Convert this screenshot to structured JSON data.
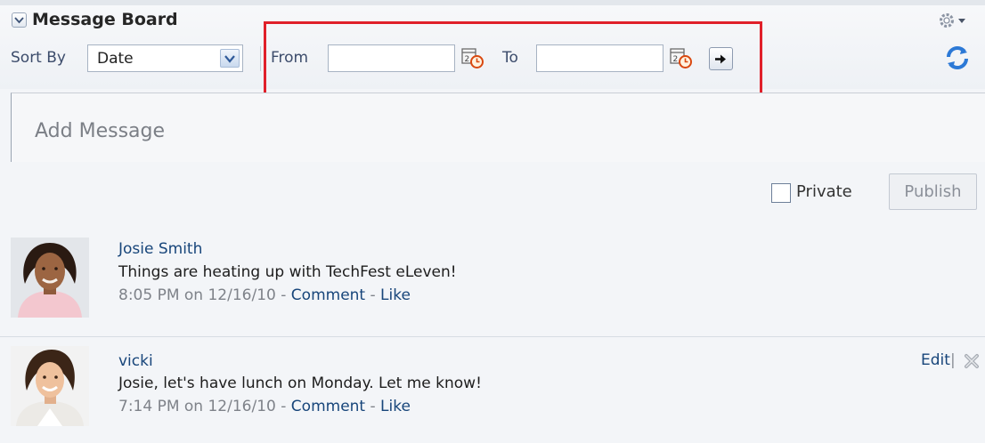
{
  "header": {
    "title": "Message Board",
    "collapse_icon": "chevron-down-icon",
    "settings_icon": "gear-icon"
  },
  "filter": {
    "sort_label": "Sort By",
    "sort_value": "Date",
    "from_label": "From",
    "from_value": "",
    "to_label": "To",
    "to_value": "",
    "go_icon": "arrow-right-icon",
    "refresh_icon": "refresh-icon"
  },
  "composer": {
    "placeholder": "Add Message",
    "private_label": "Private",
    "private_checked": false,
    "publish_label": "Publish"
  },
  "messages": [
    {
      "author": "Josie Smith",
      "text": "Things are heating up with TechFest eLeven!",
      "time": "8:05 PM on 12/16/10",
      "sep1": " - ",
      "comment": "Comment",
      "sep2": " - ",
      "like": "Like"
    },
    {
      "author": "vicki",
      "text": "Josie, let's have lunch on Monday. Let me know!",
      "time": "7:14 PM on 12/16/10",
      "sep1": " - ",
      "comment": "Comment",
      "sep2": " - ",
      "like": "Like",
      "edit": "Edit",
      "pipe": "|"
    }
  ],
  "colors": {
    "link": "#17457a",
    "highlight": "#e0202a"
  }
}
